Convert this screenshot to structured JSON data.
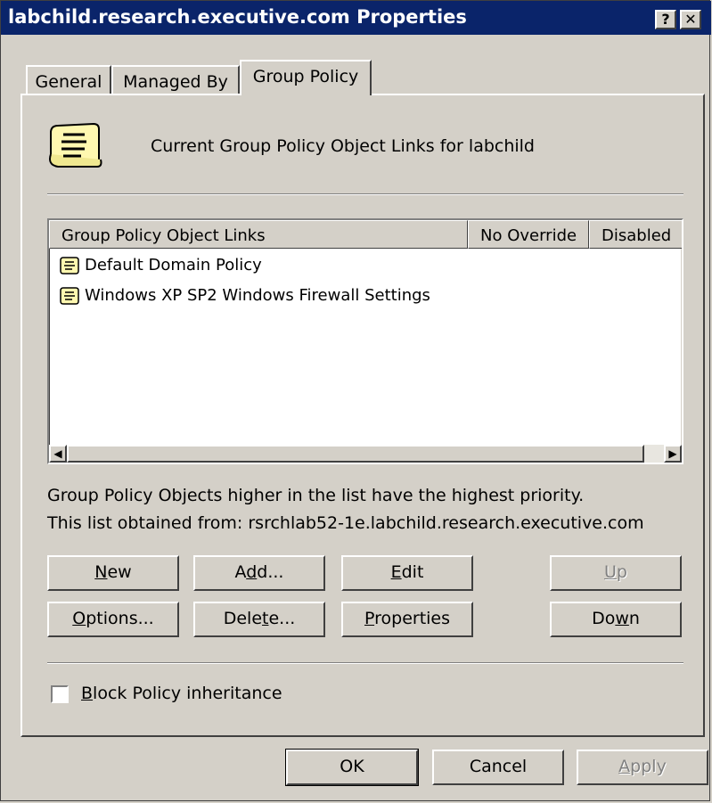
{
  "window": {
    "title": "labchild.research.executive.com Properties",
    "help_label": "?",
    "close_label": "✕"
  },
  "tabs": [
    {
      "label": "General",
      "active": false
    },
    {
      "label": "Managed By",
      "active": false
    },
    {
      "label": "Group Policy",
      "active": true
    }
  ],
  "panel": {
    "header_icon": "scroll-icon",
    "header_text": "Current Group Policy Object Links for labchild",
    "list": {
      "columns": [
        "Group Policy Object Links",
        "No Override",
        "Disabled"
      ],
      "rows": [
        {
          "name": "Default Domain Policy",
          "icon": "gpo-scroll-icon"
        },
        {
          "name": "Windows XP SP2 Windows Firewall Settings",
          "icon": "gpo-scroll-icon"
        }
      ]
    },
    "info_line1": "Group Policy Objects higher in the list have the highest priority.",
    "info_line2": "This list obtained from: rsrchlab52-1e.labchild.research.executive.com",
    "buttons": {
      "new": {
        "pre": "",
        "key": "N",
        "post": "ew"
      },
      "add": {
        "pre": "A",
        "key": "d",
        "post": "d..."
      },
      "edit": {
        "pre": "",
        "key": "E",
        "post": "dit"
      },
      "up": {
        "pre": "",
        "key": "U",
        "post": "p"
      },
      "options": {
        "pre": "",
        "key": "O",
        "post": "ptions..."
      },
      "delete": {
        "pre": "Dele",
        "key": "t",
        "post": "e..."
      },
      "properties": {
        "pre": "",
        "key": "P",
        "post": "roperties"
      },
      "down": {
        "pre": "Do",
        "key": "w",
        "post": "n"
      }
    },
    "block_inheritance": {
      "pre": "",
      "key": "B",
      "post": "lock Policy inheritance",
      "checked": false
    }
  },
  "footer": {
    "ok": "OK",
    "cancel": "Cancel",
    "apply": {
      "pre": "",
      "key": "A",
      "post": "pply"
    }
  },
  "colors": {
    "titlebar": "#0a246a",
    "face": "#d4d0c8",
    "disabled_text": "#808080"
  }
}
